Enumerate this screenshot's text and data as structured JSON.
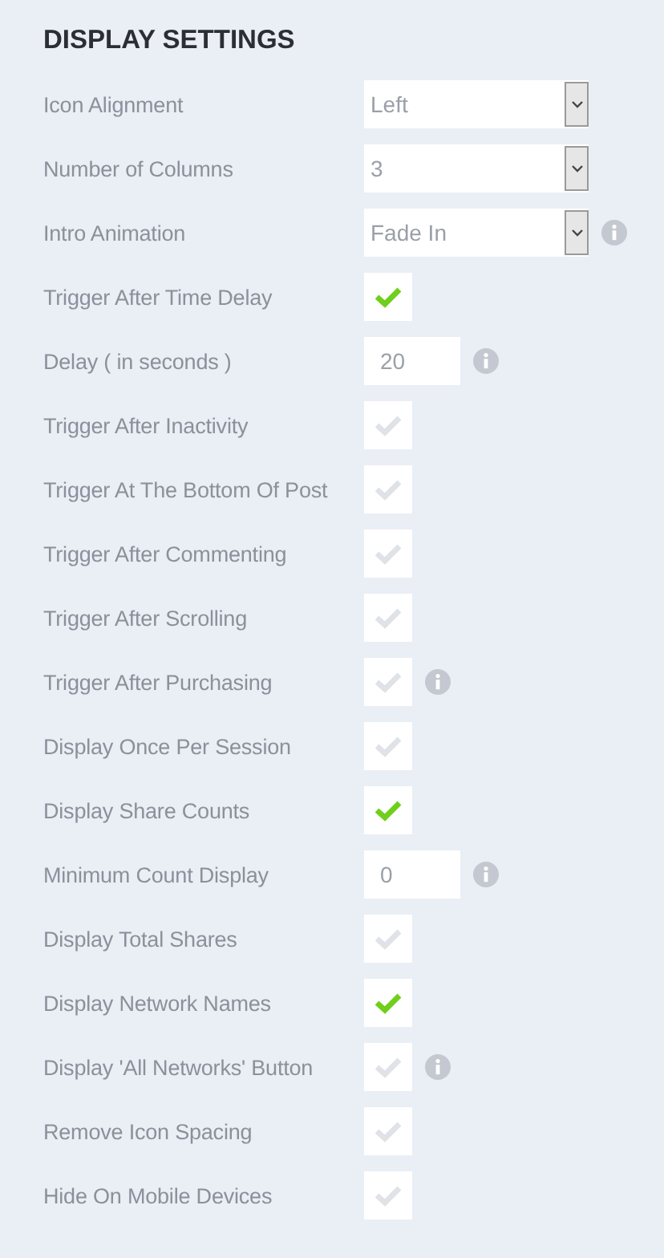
{
  "title": "DISPLAY SETTINGS",
  "settings": [
    {
      "kind": "select",
      "label": "Icon Alignment",
      "value": "Left",
      "info": false
    },
    {
      "kind": "select",
      "label": "Number of Columns",
      "value": "3",
      "info": false
    },
    {
      "kind": "select",
      "label": "Intro Animation",
      "value": "Fade In",
      "info": true
    },
    {
      "kind": "checkbox",
      "label": "Trigger After Time Delay",
      "checked": true,
      "info": false
    },
    {
      "kind": "text",
      "label": "Delay ( in seconds )",
      "value": "20",
      "info": true
    },
    {
      "kind": "checkbox",
      "label": "Trigger After Inactivity",
      "checked": false,
      "info": false
    },
    {
      "kind": "checkbox",
      "label": "Trigger At The Bottom Of Post",
      "checked": false,
      "info": false
    },
    {
      "kind": "checkbox",
      "label": "Trigger After Commenting",
      "checked": false,
      "info": false
    },
    {
      "kind": "checkbox",
      "label": "Trigger After Scrolling",
      "checked": false,
      "info": false
    },
    {
      "kind": "checkbox",
      "label": "Trigger After Purchasing",
      "checked": false,
      "info": true
    },
    {
      "kind": "checkbox",
      "label": "Display Once Per Session",
      "checked": false,
      "info": false
    },
    {
      "kind": "checkbox",
      "label": "Display Share Counts",
      "checked": true,
      "info": false
    },
    {
      "kind": "text",
      "label": "Minimum Count Display",
      "value": "0",
      "info": true
    },
    {
      "kind": "checkbox",
      "label": "Display Total Shares",
      "checked": false,
      "info": false
    },
    {
      "kind": "checkbox",
      "label": "Display Network Names",
      "checked": true,
      "info": false
    },
    {
      "kind": "checkbox",
      "label": "Display 'All Networks' Button",
      "checked": false,
      "info": true
    },
    {
      "kind": "checkbox",
      "label": "Remove Icon Spacing",
      "checked": false,
      "info": false
    },
    {
      "kind": "checkbox",
      "label": "Hide On Mobile Devices",
      "checked": false,
      "info": false
    }
  ]
}
